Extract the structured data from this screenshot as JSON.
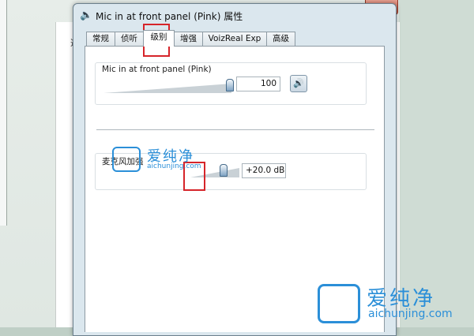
{
  "background_window": {
    "close_glyph": "x",
    "peek_text": "选"
  },
  "dialog": {
    "title": "Mic in at front panel (Pink) 属性",
    "icon": "speaker-icon"
  },
  "tabs": [
    {
      "label": "常规"
    },
    {
      "label": "侦听"
    },
    {
      "label": "级别",
      "active": true
    },
    {
      "label": "增强"
    },
    {
      "label": "VoizReal Exp"
    },
    {
      "label": "高级"
    }
  ],
  "levels": {
    "mic": {
      "label": "Mic in at front panel (Pink)",
      "value": "100",
      "level_fraction": 1.0,
      "mute_icon": "speaker-volume-icon"
    },
    "boost": {
      "label": "麦克风加强",
      "value": "+20.0 dB",
      "level_fraction": 0.67
    }
  },
  "watermark": {
    "chinese": "爱纯净",
    "url": "aichunjing.com"
  },
  "colors": {
    "highlight_box": "#d6242a",
    "watermark": "#2b8fd8"
  }
}
